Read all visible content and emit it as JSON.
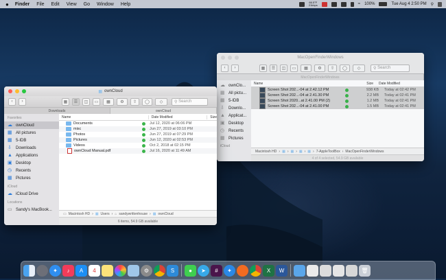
{
  "menubar": {
    "apple": "",
    "items": [
      "Finder",
      "File",
      "Edit",
      "View",
      "Go",
      "Window",
      "Help"
    ],
    "status_top": "66.5°F",
    "status_bottom": "21kbps",
    "battery": "100%",
    "clock": "Tue Aug 4  2:50 PM"
  },
  "owncloud_window": {
    "title": "ownCloud",
    "search_placeholder": "Search",
    "tabs": [
      "Downloads",
      "ownCloud"
    ],
    "sidebar": {
      "favorites_heading": "Favorites",
      "favorites": [
        "ownCloud",
        "All pictures",
        "5-IDB",
        "Downloads",
        "Applications",
        "Desktop",
        "Recents",
        "Pictures"
      ],
      "icloud_heading": "iCloud",
      "icloud": [
        "iCloud Drive"
      ],
      "locations_heading": "Locations",
      "locations": [
        "Sandy's MacBook..."
      ]
    },
    "columns": {
      "name": "Name",
      "date": "Date Modified",
      "size": "Size"
    },
    "files": [
      {
        "name": "Documents",
        "date": "Jul 12, 2020 at 06:06 PM",
        "type": "folder"
      },
      {
        "name": "misc",
        "date": "Jun 27, 2019 at 03:10 PM",
        "type": "folder"
      },
      {
        "name": "Photos",
        "date": "Jun 27, 2019 at 07:29 PM",
        "type": "folder"
      },
      {
        "name": "Pictures",
        "date": "Jun 12, 2020 at 02:53 PM",
        "type": "folder"
      },
      {
        "name": "Videos",
        "date": "Oct 2, 2018 at 02:15 PM",
        "type": "folder"
      },
      {
        "name": "ownCloud Manual.pdf",
        "date": "Jul 16, 2020 at 11:49 AM",
        "type": "pdf"
      }
    ],
    "path": [
      "Macintosh HD",
      "Users",
      "sandywrittenhouse",
      "ownCloud"
    ],
    "status": "6 items, 54.9 GB available"
  },
  "mof_window": {
    "title": "MacOpenFinderWindows",
    "tab": "MacOpenFinderWindows",
    "search_placeholder": "Search",
    "sidebar": [
      "ownClo...",
      "All pictu...",
      "5-IDB",
      "Downlo...",
      "Applicat...",
      "Desktop",
      "Recents",
      "Pictures"
    ],
    "icloud_heading": "iCloud",
    "columns": {
      "name": "Name",
      "size": "Size",
      "date": "Date Modified"
    },
    "files": [
      {
        "name": "Screen Shot 202...-04 at 2.42.12 PM",
        "size": "938 KB",
        "date": "Today at 02:42 PM"
      },
      {
        "name": "Screen Shot 202...-04 at 2.41.30 PM",
        "size": "2.2 MB",
        "date": "Today at 02:41 PM"
      },
      {
        "name": "Screen Shot 2020...at 2.41.00 PM (2)",
        "size": "1.2 MB",
        "date": "Today at 02:41 PM"
      },
      {
        "name": "Screen Shot 202...-04 at 2.41.00 PM",
        "size": "1.5 MB",
        "date": "Today at 02:41 PM"
      }
    ],
    "path": [
      "Macintosh HD",
      "7-AppleToolBox",
      "MacOpenFinderWindows"
    ],
    "status": "4 of 4 selected, 54.9 GB available"
  },
  "colors": {
    "close": "#fe5f57",
    "minimize": "#febc2e",
    "zoom": "#28c840",
    "accent": "#2a7ad9",
    "sync_ok": "#3bb54a"
  },
  "dock": [
    "finder-icon",
    "launchpad-icon",
    "safari-icon",
    "music-icon",
    "app-store-icon",
    "calendar-icon",
    "notes-icon",
    "photos-icon",
    "preview-icon",
    "system-preferences-icon",
    "chrome-icon",
    "snagit-icon",
    "messages-icon",
    "telegram-icon",
    "slack-icon",
    "compass-icon",
    "firefox-icon",
    "chrome2-icon",
    "excel-icon",
    "word-icon",
    "downloads-folder-icon",
    "stack-icon",
    "stack2-icon",
    "stack3-icon",
    "stack4-icon",
    "trash-icon"
  ]
}
